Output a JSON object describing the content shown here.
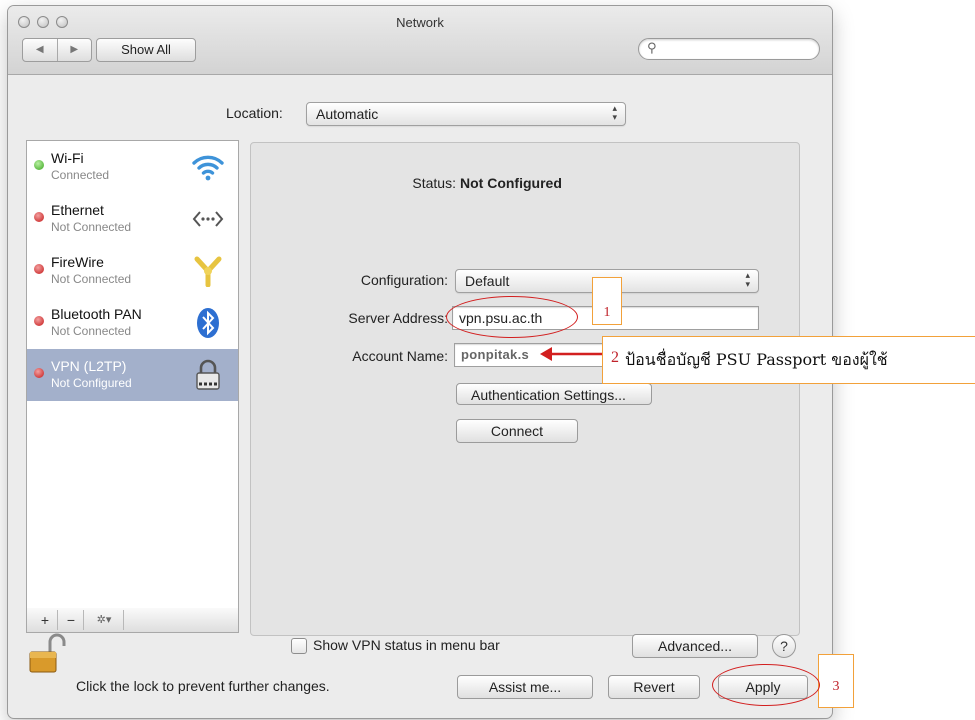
{
  "window": {
    "title": "Network",
    "show_all": "Show All",
    "search_placeholder": ""
  },
  "location": {
    "label": "Location:",
    "value": "Automatic"
  },
  "services": [
    {
      "name": "Wi-Fi",
      "status": "Connected",
      "dot": "green",
      "icon": "wifi-icon"
    },
    {
      "name": "Ethernet",
      "status": "Not Connected",
      "dot": "red",
      "icon": "ethernet-icon"
    },
    {
      "name": "FireWire",
      "status": "Not Connected",
      "dot": "red",
      "icon": "firewire-icon"
    },
    {
      "name": "Bluetooth PAN",
      "status": "Not Connected",
      "dot": "red",
      "icon": "bluetooth-icon"
    },
    {
      "name": "VPN (L2TP)",
      "status": "Not Configured",
      "dot": "red",
      "icon": "lock-icon",
      "selected": true
    }
  ],
  "sidebar_tools": {
    "add": "+",
    "remove": "−",
    "gear": "✲▾"
  },
  "detail": {
    "status_label": "Status:",
    "status_value": "Not Configured",
    "configuration_label": "Configuration:",
    "configuration_value": "Default",
    "server_label": "Server Address:",
    "server_value": "vpn.psu.ac.th",
    "account_label": "Account Name:",
    "account_value": "ponpitak.s",
    "auth_button": "Authentication Settings...",
    "connect_button": "Connect",
    "show_vpn_label": "Show VPN status in menu bar",
    "advanced_button": "Advanced...",
    "help_button": "?"
  },
  "bottom": {
    "lock_text": "Click the lock to prevent further changes.",
    "assist_button": "Assist me...",
    "revert_button": "Revert",
    "apply_button": "Apply"
  },
  "annotations": {
    "n1": "1",
    "n2": "2",
    "n2_text": "ป้อนชื่อบัญชี PSU Passport ของผู้ใช้",
    "n3": "3"
  },
  "colors": {
    "selection": "#a3b0cb",
    "annotation_red": "#d21f1f",
    "annotation_border": "#f2a13a"
  }
}
